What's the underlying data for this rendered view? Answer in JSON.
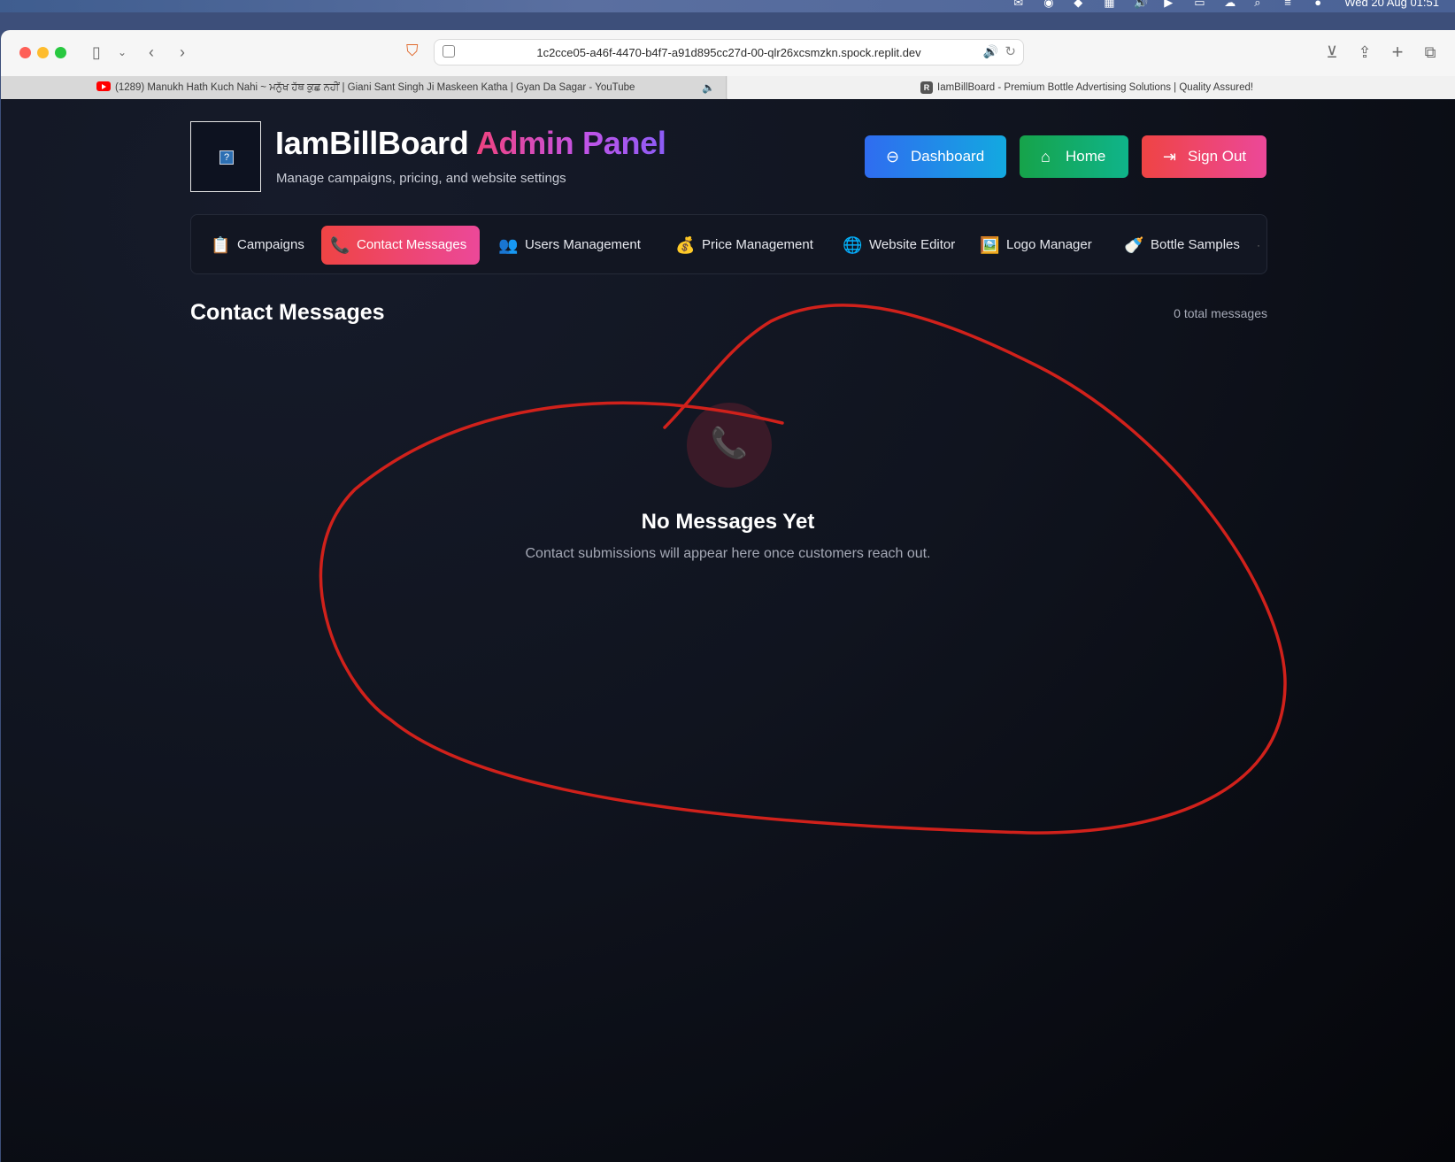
{
  "menubar": {
    "clock": "Wed 20 Aug  01:51",
    "icons": [
      "mail-icon",
      "app-icon",
      "airplay-icon",
      "keyboard-icon",
      "volume-icon",
      "play-icon",
      "battery-icon",
      "cloud-icon",
      "search-icon",
      "control-center-icon",
      "siri-icon"
    ]
  },
  "browser": {
    "url": "1c2cce05-a46f-4470-b4f7-a91d895cc27d-00-qlr26xcsmzkn.spock.replit.dev",
    "tabs": [
      {
        "title": "(1289) Manukh Hath Kuch Nahi ~ ਮਨੁੱਖ ਹੱਥ ਕੁਛ ਨਹੀਂ | Giani Sant Singh Ji Maskeen Katha | Gyan Da Sagar - YouTube",
        "icon": "youtube-icon"
      },
      {
        "title": "IamBillBoard - Premium Bottle Advertising Solutions | Quality Assured!",
        "icon": "replit-icon"
      }
    ]
  },
  "header": {
    "brand_main": "IamBillBoard",
    "brand_accent": "Admin Panel",
    "tagline": "Manage campaigns, pricing, and website settings",
    "buttons": [
      {
        "label": "Dashboard",
        "icon": "arrow-left-circle-icon",
        "color": "#2f6cf0"
      },
      {
        "label": "Home",
        "icon": "home-icon",
        "color": "#16a34a"
      },
      {
        "label": "Sign Out",
        "icon": "sign-out-icon",
        "color": "#ef4444"
      }
    ]
  },
  "nav": {
    "items": [
      {
        "label": "Campaigns",
        "icon": "📋"
      },
      {
        "label": "Contact Messages",
        "icon": "📞",
        "active": true
      },
      {
        "label": "Users Management",
        "icon": "👥"
      },
      {
        "label": "Price Management",
        "icon": "💰"
      },
      {
        "label": "Website Editor",
        "icon": "🌐"
      },
      {
        "label": "Logo Manager",
        "icon": "🖼️"
      },
      {
        "label": "Bottle Samples",
        "icon": "🍼"
      }
    ]
  },
  "main": {
    "title": "Contact Messages",
    "count_text": "0 total messages",
    "empty": {
      "icon": "📞",
      "title": "No Messages Yet",
      "description": "Contact submissions will appear here once customers reach out."
    }
  },
  "colors": {
    "accent_gradient_start": "#ef4444",
    "accent_gradient_end": "#ec4899",
    "annotation_stroke": "#d0211b",
    "page_background": "#10141f"
  }
}
